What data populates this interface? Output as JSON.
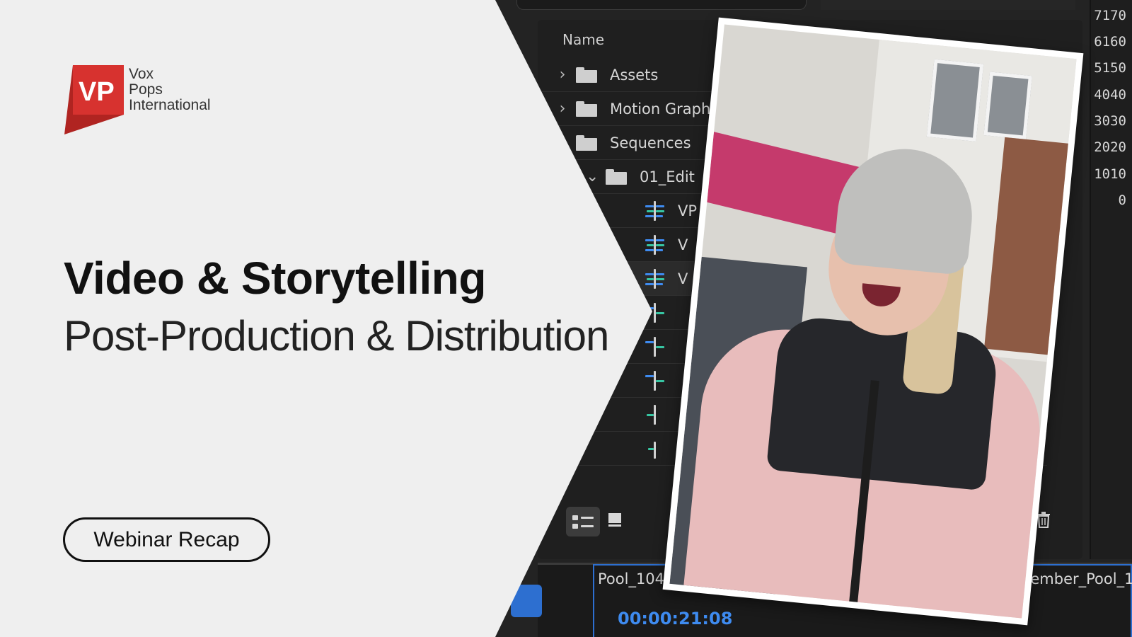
{
  "brand": {
    "logo_initials": "VP",
    "name_line1": "Vox",
    "name_line2": "Pops",
    "name_line3": "International",
    "accent_color": "#d7322f"
  },
  "hero": {
    "title": "Video & Storytelling",
    "subtitle": "Post-Production & Distribution",
    "badge": "Webinar Recap"
  },
  "editor": {
    "column_header": "Name",
    "rows": [
      {
        "label": "Assets",
        "expanded": false
      },
      {
        "label": "Motion Graph",
        "expanded": false
      },
      {
        "label": "Sequences",
        "expanded": true
      },
      {
        "label": "01_Edit",
        "expanded": true
      },
      {
        "label": "VP"
      },
      {
        "label": "V"
      },
      {
        "label": "V"
      }
    ],
    "ruler_values": [
      "7170",
      "6160",
      "5150",
      "4040",
      "3030",
      "2020",
      "1010",
      "0"
    ],
    "timeline": {
      "clip_left": "Pool_1045_2023_",
      "clip_right": "VPI_December_Pool_1",
      "timecode": "00:00:21:08"
    },
    "icons": [
      "list-view-icon",
      "icon-view-icon",
      "new-item-icon",
      "trash-icon",
      "chevron-right-icon",
      "folder-icon",
      "sequence-icon"
    ]
  }
}
